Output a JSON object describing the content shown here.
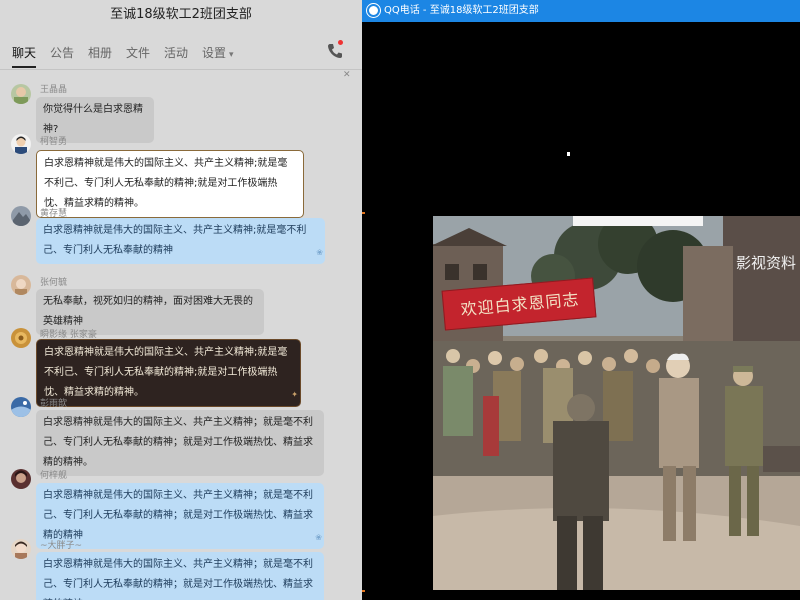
{
  "chat": {
    "title": "至诚18级软工2班团支部",
    "tabs": [
      {
        "label": "聊天"
      },
      {
        "label": "公告"
      },
      {
        "label": "相册"
      },
      {
        "label": "文件"
      },
      {
        "label": "活动"
      },
      {
        "label": "设置"
      }
    ],
    "messages": [
      {
        "sender": "王晶晶",
        "text": "你觉得什么是白求恩精神?",
        "style": "grey"
      },
      {
        "sender": "柯智勇",
        "text": "白求恩精神就是伟大的国际主义、共产主义精神;就是毫不利己、专门利人无私奉献的精神;就是对工作极端热忱、精益求精的精神。",
        "style": "white"
      },
      {
        "sender": "黄存慧",
        "text": "白求恩精神就是伟大的国际主义、共产主义精神;就是毫不利己、专门利人无私奉献的精神",
        "style": "blue"
      },
      {
        "sender": "张何毓",
        "text": "无私奉献，视死如归的精神，面对困难大无畏的英雄精神",
        "style": "grey"
      },
      {
        "sender": "瞬影缘  张家豪",
        "text": "白求恩精神就是伟大的国际主义、共产主义精神;就是毫不利己、专门利人无私奉献的精神;就是对工作极端热忱、精益求精的精神。",
        "style": "dark"
      },
      {
        "sender": "彭雨歆",
        "text": "白求恩精神就是伟大的国际主义、共产主义精神；就是毫不利己、专门利人无私奉献的精神；就是对工作极端热忱、精益求精的精神。",
        "style": "grey"
      },
      {
        "sender": "何梓舰",
        "text": "白求恩精神就是伟大的国际主义、共产主义精神；就是毫不利己、专门利人无私奉献的精神；就是对工作极端热忱、精益求精的精神",
        "style": "blue"
      },
      {
        "sender": "~大胖子~",
        "text": "白求恩精神就是伟大的国际主义、共产主义精神；就是毫不利己、专门利人无私奉献的精神；就是对工作极端热忱、精益求精的精神",
        "style": "blue"
      }
    ]
  },
  "call": {
    "title": "QQ电话 - 至诚18级软工2班团支部",
    "video": {
      "banner_text": "欢迎白求恩同志",
      "watermark_text": "影视资料"
    }
  },
  "colors": {
    "titlebar_blue": "#1c86e4",
    "banner_red": "#c3242d",
    "bubble_blue": "#bcdcf6",
    "bubble_dark": "#2e2320"
  }
}
